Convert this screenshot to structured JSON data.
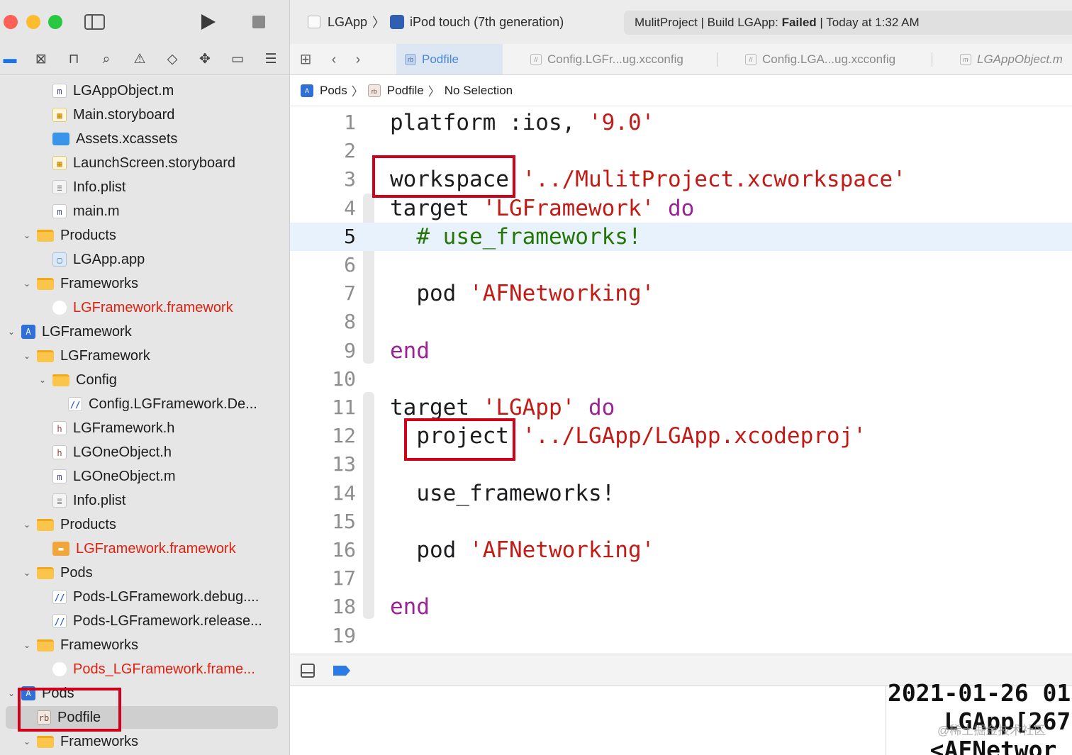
{
  "window": {
    "scheme": "LGApp",
    "device": "iPod touch (7th generation)",
    "activity": {
      "prefix": "MulitProject | Build LGApp: ",
      "status": "Failed",
      "suffix": " | Today at 1:32 AM"
    }
  },
  "navigator_icons": [
    "folder-icon",
    "source-control-icon",
    "hierarchy-icon",
    "search-icon",
    "warning-icon",
    "test-icon",
    "debug-icon",
    "breakpoint-icon",
    "report-icon"
  ],
  "tree": [
    {
      "label": "LGAppObject.m",
      "indent": 3,
      "icon": "m",
      "disclosure": "none"
    },
    {
      "label": "Main.storyboard",
      "indent": 3,
      "icon": "sb",
      "disclosure": "none"
    },
    {
      "label": "Assets.xcassets",
      "indent": 3,
      "icon": "xcassets",
      "disclosure": "none"
    },
    {
      "label": "LaunchScreen.storyboard",
      "indent": 3,
      "icon": "sb",
      "disclosure": "none"
    },
    {
      "label": "Info.plist",
      "indent": 3,
      "icon": "plist",
      "disclosure": "none"
    },
    {
      "label": "main.m",
      "indent": 3,
      "icon": "m",
      "disclosure": "none"
    },
    {
      "label": "Products",
      "indent": 2,
      "icon": "folder",
      "disclosure": "open"
    },
    {
      "label": "LGApp.app",
      "indent": 3,
      "icon": "app",
      "disclosure": "none"
    },
    {
      "label": "Frameworks",
      "indent": 2,
      "icon": "folder",
      "disclosure": "open"
    },
    {
      "label": "LGFramework.framework",
      "indent": 3,
      "icon": "fw-missing",
      "disclosure": "none",
      "red": true
    },
    {
      "label": "LGFramework",
      "indent": 1,
      "icon": "proj",
      "disclosure": "open"
    },
    {
      "label": "LGFramework",
      "indent": 2,
      "icon": "folder",
      "disclosure": "open"
    },
    {
      "label": "Config",
      "indent": 3,
      "icon": "folder",
      "disclosure": "open"
    },
    {
      "label": "Config.LGFramework.De...",
      "indent": 4,
      "icon": "cfg",
      "disclosure": "none"
    },
    {
      "label": "LGFramework.h",
      "indent": 3,
      "icon": "h",
      "disclosure": "none"
    },
    {
      "label": "LGOneObject.h",
      "indent": 3,
      "icon": "h",
      "disclosure": "none"
    },
    {
      "label": "LGOneObject.m",
      "indent": 3,
      "icon": "m",
      "disclosure": "none"
    },
    {
      "label": "Info.plist",
      "indent": 3,
      "icon": "plist",
      "disclosure": "none"
    },
    {
      "label": "Products",
      "indent": 2,
      "icon": "folder",
      "disclosure": "open"
    },
    {
      "label": "LGFramework.framework",
      "indent": 3,
      "icon": "fw",
      "disclosure": "none",
      "red": true
    },
    {
      "label": "Pods",
      "indent": 2,
      "icon": "folder",
      "disclosure": "open"
    },
    {
      "label": "Pods-LGFramework.debug....",
      "indent": 3,
      "icon": "cfg",
      "disclosure": "none"
    },
    {
      "label": "Pods-LGFramework.release...",
      "indent": 3,
      "icon": "cfg",
      "disclosure": "none"
    },
    {
      "label": "Frameworks",
      "indent": 2,
      "icon": "folder",
      "disclosure": "open"
    },
    {
      "label": "Pods_LGFramework.frame...",
      "indent": 3,
      "icon": "fw-missing",
      "disclosure": "none",
      "red": true
    },
    {
      "label": "Pods",
      "indent": 1,
      "icon": "proj",
      "disclosure": "open"
    },
    {
      "label": "Podfile",
      "indent": 2,
      "icon": "rb",
      "disclosure": "none",
      "selected": true
    },
    {
      "label": "Frameworks",
      "indent": 2,
      "icon": "folder",
      "disclosure": "open"
    }
  ],
  "tabs": [
    {
      "label": "Podfile",
      "active": true,
      "icon": "rb"
    },
    {
      "label": "Config.LGFr...ug.xcconfig",
      "active": false,
      "icon": "cfg"
    },
    {
      "label": "Config.LGA...ug.xcconfig",
      "active": false,
      "icon": "cfg"
    },
    {
      "label": "LGAppObject.m",
      "active": false,
      "icon": "m",
      "italic": true
    }
  ],
  "jumpbar": {
    "project": "Pods",
    "file": "Podfile",
    "symbol": "No Selection"
  },
  "editor": {
    "current_line": 5,
    "lines": [
      {
        "n": "1",
        "tokens": [
          {
            "t": "platform :ios, ",
            "c": "plain"
          },
          {
            "t": "'9.0'",
            "c": "str"
          }
        ]
      },
      {
        "n": "2",
        "tokens": []
      },
      {
        "n": "3",
        "tokens": [
          {
            "t": "workspace ",
            "c": "plain"
          },
          {
            "t": "'../MulitProject.xcworkspace'",
            "c": "str"
          }
        ]
      },
      {
        "n": "4",
        "tokens": [
          {
            "t": "target ",
            "c": "plain"
          },
          {
            "t": "'LGFramework'",
            "c": "str"
          },
          {
            "t": " do",
            "c": "kw"
          }
        ]
      },
      {
        "n": "5",
        "tokens": [
          {
            "t": "  # use_frameworks!",
            "c": "com"
          }
        ]
      },
      {
        "n": "6",
        "tokens": []
      },
      {
        "n": "7",
        "tokens": [
          {
            "t": "  pod ",
            "c": "plain"
          },
          {
            "t": "'AFNetworking'",
            "c": "str"
          }
        ]
      },
      {
        "n": "8",
        "tokens": []
      },
      {
        "n": "9",
        "tokens": [
          {
            "t": "end",
            "c": "kw"
          }
        ]
      },
      {
        "n": "10",
        "tokens": []
      },
      {
        "n": "11",
        "tokens": [
          {
            "t": "target ",
            "c": "plain"
          },
          {
            "t": "'LGApp'",
            "c": "str"
          },
          {
            "t": " do",
            "c": "kw"
          }
        ]
      },
      {
        "n": "12",
        "tokens": [
          {
            "t": "  project ",
            "c": "plain"
          },
          {
            "t": "'../LGApp/LGApp.xcodeproj'",
            "c": "str"
          }
        ]
      },
      {
        "n": "13",
        "tokens": []
      },
      {
        "n": "14",
        "tokens": [
          {
            "t": "  use_frameworks!",
            "c": "plain"
          }
        ]
      },
      {
        "n": "15",
        "tokens": []
      },
      {
        "n": "16",
        "tokens": [
          {
            "t": "  pod ",
            "c": "plain"
          },
          {
            "t": "'AFNetworking'",
            "c": "str"
          }
        ]
      },
      {
        "n": "17",
        "tokens": []
      },
      {
        "n": "18",
        "tokens": [
          {
            "t": "end",
            "c": "kw"
          }
        ]
      },
      {
        "n": "19",
        "tokens": []
      }
    ]
  },
  "console": {
    "lines": [
      "2021-01-26 01",
      "    LGApp[267",
      "   <AFNetwor"
    ]
  },
  "watermark": "@稀土掘金技术社区",
  "colors": {
    "keyword": "#9b2393",
    "string": "#c41a16",
    "comment": "#267507",
    "annotation": "#d0021b",
    "missing_file": "#e3210f"
  }
}
